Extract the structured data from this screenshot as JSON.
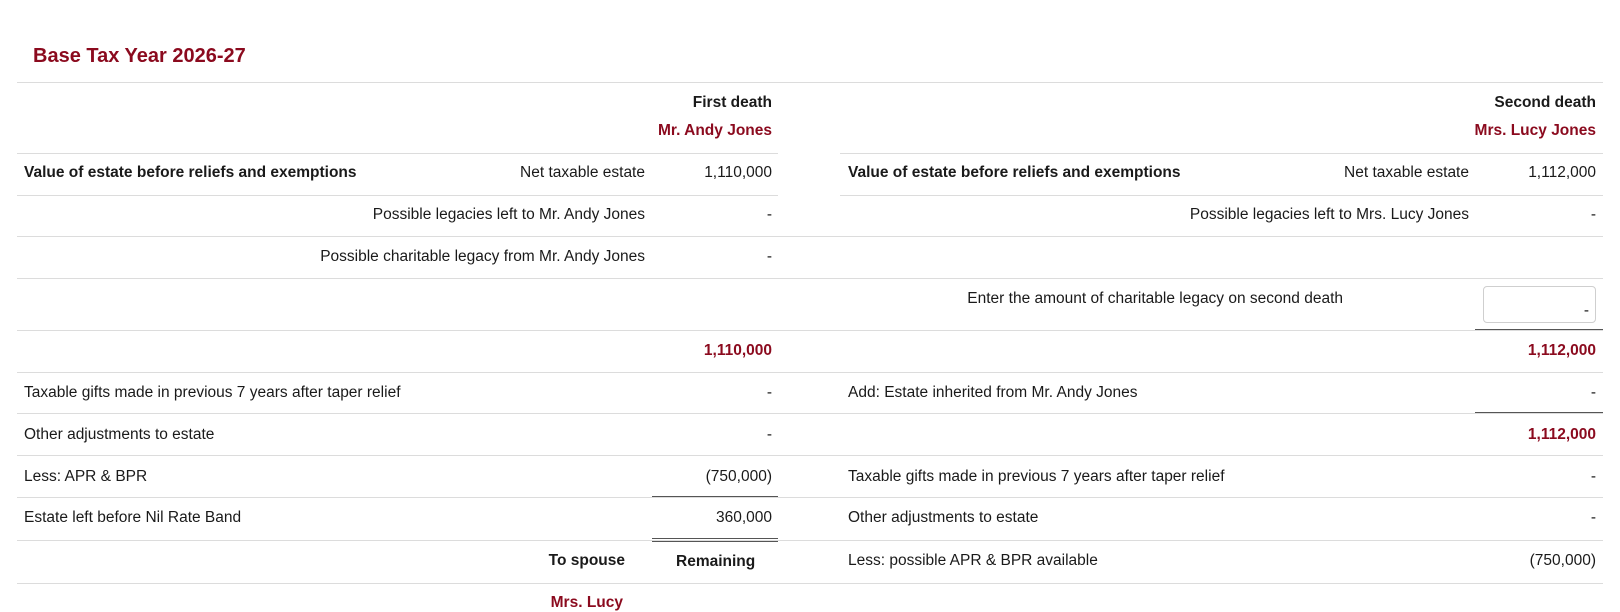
{
  "page": {
    "title": "Base Tax Year 2026-27"
  },
  "first": {
    "header": "First death",
    "person": "Mr. Andy Jones",
    "rows": {
      "value_heading": "Value of estate before reliefs and exemptions",
      "net_label": "Net taxable estate",
      "net_value": "1,110,000",
      "legacies_label": "Possible legacies left to Mr. Andy Jones",
      "legacies_value": "-",
      "charitable_label": "Possible charitable legacy from Mr. Andy Jones",
      "charitable_value": "-",
      "subtotal": "1,110,000",
      "gifts_label": "Taxable gifts made in previous 7 years after taper relief",
      "gifts_value": "-",
      "adjust_label": "Other adjustments to estate",
      "adjust_value": "-",
      "apr_label": "Less: APR & BPR",
      "apr_value": "(750,000)",
      "nrb_label": "Estate left before Nil Rate Band",
      "nrb_value": "360,000",
      "to_spouse": "To spouse",
      "remaining": "Remaining",
      "spouse_name": "Mrs. Lucy"
    }
  },
  "second": {
    "header": "Second death",
    "person": "Mrs. Lucy Jones",
    "rows": {
      "value_heading": "Value of estate before reliefs and exemptions",
      "net_label": "Net taxable estate",
      "net_value": "1,112,000",
      "legacies_label": "Possible legacies left to Mrs. Lucy Jones",
      "legacies_value": "-",
      "charitable_input_label": "Enter the amount of charitable legacy on second death",
      "charitable_input_value": "-",
      "subtotal": "1,112,000",
      "inherited_label": "Add: Estate inherited from Mr. Andy Jones",
      "inherited_value": "-",
      "subtotal2": "1,112,000",
      "gifts_label": "Taxable gifts made in previous 7 years after taper relief",
      "gifts_value": "-",
      "adjust_label": "Other adjustments to estate",
      "adjust_value": "-",
      "apr_label": "Less: possible APR & BPR available",
      "apr_value": "(750,000)"
    }
  },
  "colors": {
    "accent": "#8b0a1e",
    "border": "#dcdcdc"
  }
}
